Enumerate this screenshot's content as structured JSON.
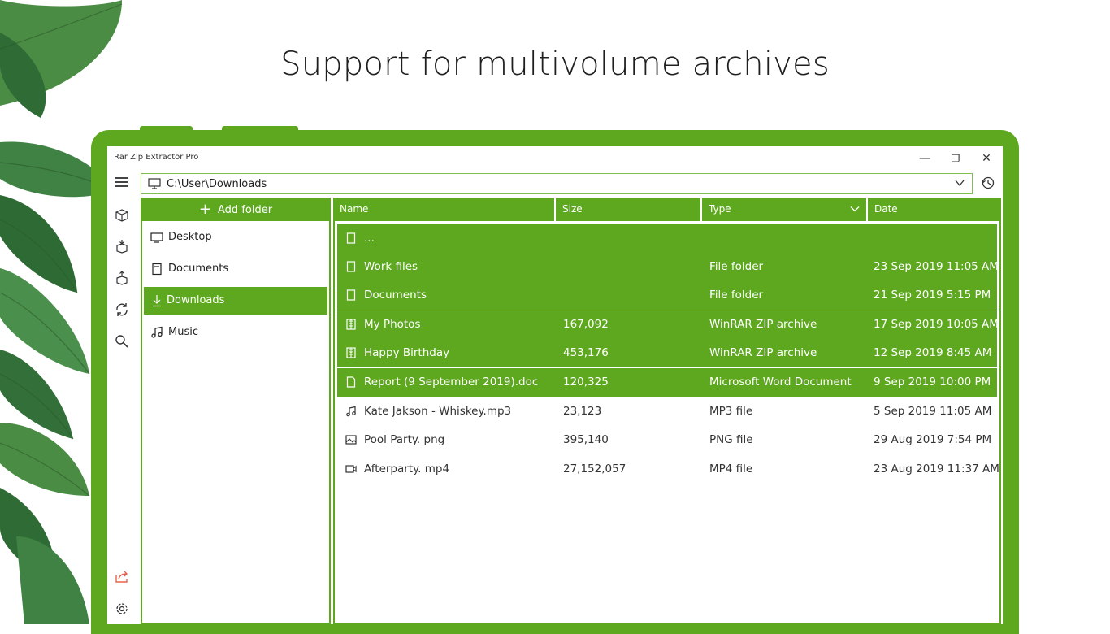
{
  "headline": "Support for multivolume archives",
  "window": {
    "title": "Rar Zip Extractor Pro",
    "minimize": "—",
    "maximize": "❐",
    "close": "✕"
  },
  "address": {
    "path": "C:\\User\\Downloads"
  },
  "folders": {
    "add_label": "Add folder",
    "items": [
      {
        "label": "Desktop",
        "icon": "desktop-icon"
      },
      {
        "label": "Documents",
        "icon": "document-icon"
      },
      {
        "label": "Downloads",
        "icon": "download-icon",
        "selected": true
      },
      {
        "label": "Music",
        "icon": "music-icon"
      }
    ]
  },
  "columns": {
    "name": "Name",
    "size": "Size",
    "type": "Type",
    "date": "Date"
  },
  "files": [
    {
      "name": "...",
      "size": "",
      "type": "",
      "date": "",
      "icon": "file-icon",
      "selected": true
    },
    {
      "name": "Work files",
      "size": "",
      "type": "File folder",
      "date": "23 Sep 2019 11:05 AM",
      "icon": "file-icon",
      "selected": true
    },
    {
      "name": "Documents",
      "size": "",
      "type": "File folder",
      "date": "21 Sep 2019 5:15 PM",
      "icon": "file-icon",
      "selected": true
    },
    {
      "name": "My Photos",
      "size": "167,092",
      "type": "WinRAR ZIP archive",
      "date": "17 Sep 2019 10:05 AM",
      "icon": "archive-icon",
      "selected": true
    },
    {
      "name": "Happy Birthday",
      "size": "453,176",
      "type": "WinRAR ZIP archive",
      "date": "12 Sep 2019 8:45 AM",
      "icon": "archive-icon",
      "selected": true
    },
    {
      "name": "Report (9 September 2019).doc",
      "size": "120,325",
      "type": "Microsoft Word Document",
      "date": "9 Sep 2019 10:00 PM",
      "icon": "word-doc-icon",
      "selected": true
    },
    {
      "name": "Kate Jakson - Whiskey.mp3",
      "size": "23,123",
      "type": "MP3 file",
      "date": "5 Sep 2019 11:05 AM",
      "icon": "music-icon",
      "selected": false
    },
    {
      "name": "Pool Party. png",
      "size": "395,140",
      "type": "PNG file",
      "date": "29 Aug 2019 7:54 PM",
      "icon": "image-icon",
      "selected": false
    },
    {
      "name": "Afterparty. mp4",
      "size": "27,152,057",
      "type": "MP4 file",
      "date": "23 Aug 2019 11:37 AM",
      "icon": "video-icon",
      "selected": false
    }
  ],
  "colors": {
    "accent": "#5ea81f",
    "share": "#e8604a"
  }
}
